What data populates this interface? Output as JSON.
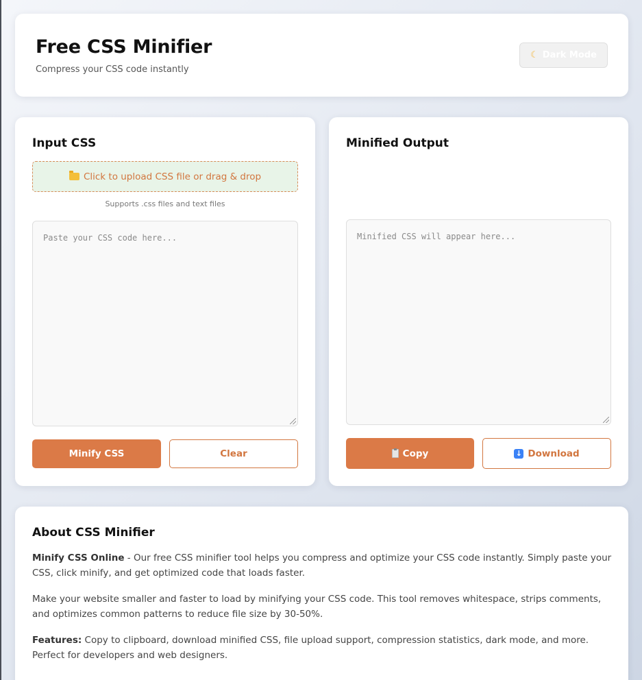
{
  "header": {
    "title": "Free CSS Minifier",
    "subtitle": "Compress your CSS code instantly",
    "dark_mode_label": "Dark Mode"
  },
  "input_panel": {
    "title": "Input CSS",
    "upload_label": "Click to upload CSS file or drag & drop",
    "upload_hint": "Supports .css files and text files",
    "placeholder": "Paste your CSS code here...",
    "minify_label": "Minify CSS",
    "clear_label": "Clear"
  },
  "output_panel": {
    "title": "Minified Output",
    "placeholder": "Minified CSS will appear here...",
    "copy_label": "Copy",
    "download_label": "Download"
  },
  "about": {
    "title": "About CSS Minifier",
    "p1_strong": "Minify CSS Online",
    "p1_text": " - Our free CSS minifier tool helps you compress and optimize your CSS code instantly. Simply paste your CSS, click minify, and get optimized code that loads faster.",
    "p2_text": "Make your website smaller and faster to load by minifying your CSS code. This tool removes whitespace, strips comments, and optimizes common patterns to reduce file size by 30-50%.",
    "p3_strong": "Features:",
    "p3_text": " Copy to clipboard, download minified CSS, file upload support, compression statistics, dark mode, and more. Perfect for developers and web designers."
  },
  "colors": {
    "accent": "#db7a47",
    "upload_bg": "#e8f4e8"
  }
}
